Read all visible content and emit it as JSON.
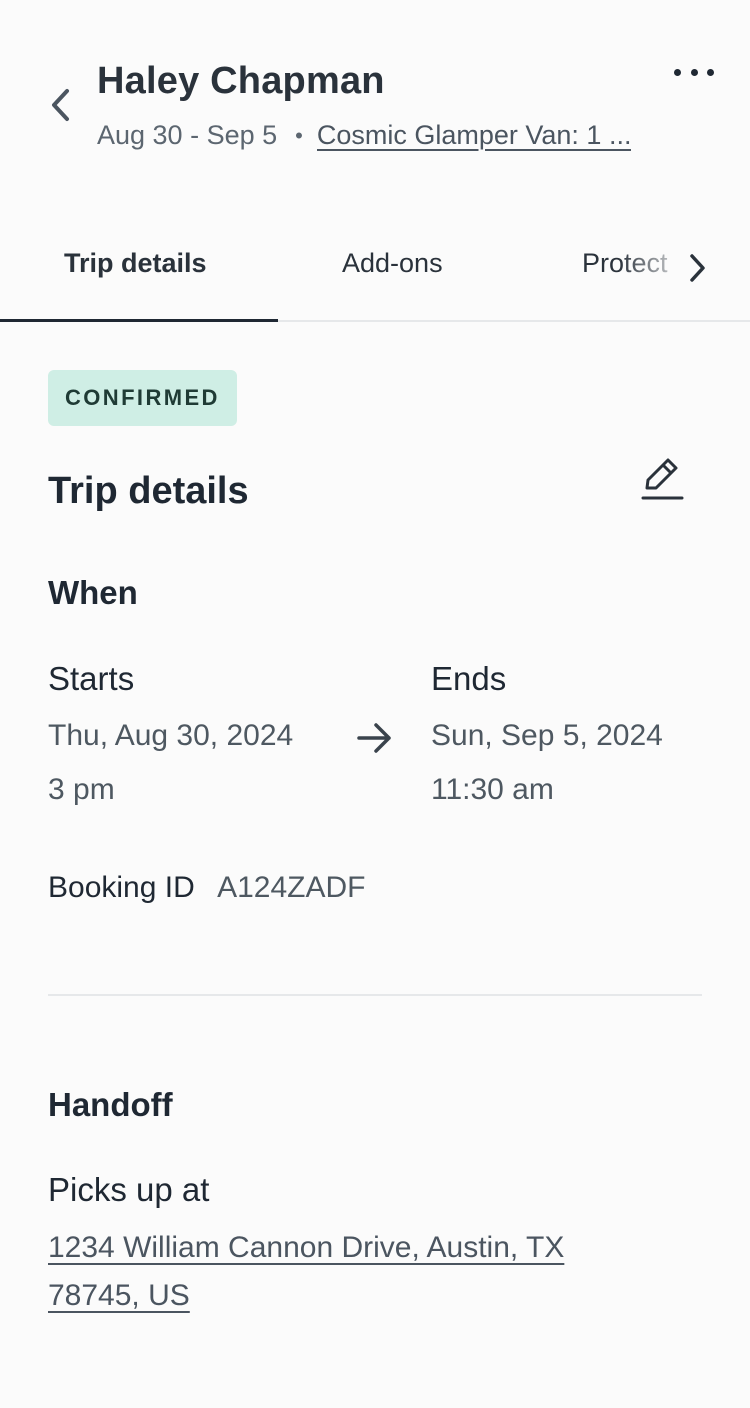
{
  "header": {
    "guest_name": "Haley Chapman",
    "dates": "Aug 30 - Sep 5",
    "separator": "•",
    "vehicle": "Cosmic Glamper Van: 1 ..."
  },
  "tabs": [
    {
      "label": "Trip details",
      "active": true
    },
    {
      "label": "Add-ons",
      "active": false
    },
    {
      "label": "Protect",
      "active": false
    }
  ],
  "status_badge": "CONFIRMED",
  "trip": {
    "title": "Trip details",
    "when_label": "When",
    "starts": {
      "label": "Starts",
      "date": "Thu, Aug 30, 2024",
      "time": "3 pm"
    },
    "ends": {
      "label": "Ends",
      "date": "Sun, Sep 5, 2024",
      "time": "11:30 am"
    },
    "booking_label": "Booking ID",
    "booking_id": "A124ZADF"
  },
  "handoff": {
    "title": "Handoff",
    "pickup_label": "Picks up at",
    "address": "1234 William Cannon Drive, Austin, TX 78745, US"
  },
  "icons": [
    "chevron-left-icon",
    "more-horizontal-icon",
    "chevron-right-icon",
    "edit-pencil-icon",
    "arrow-right-icon"
  ],
  "colors": {
    "badge_bg": "#cfeee5",
    "text_primary": "#1f2833",
    "text_secondary": "#4e5861"
  }
}
